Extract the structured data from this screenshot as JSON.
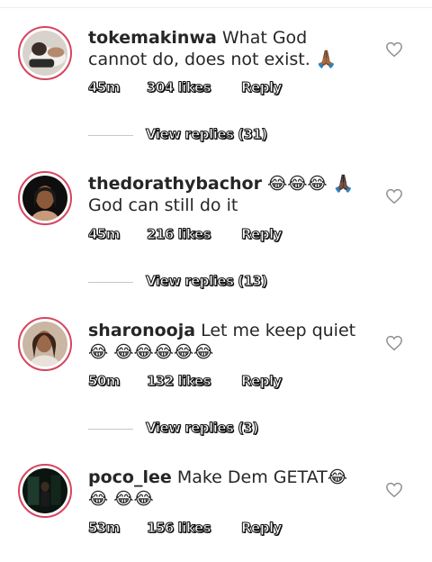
{
  "comments": [
    {
      "username": "tokemakinwa",
      "text": "What God cannot do, does not exist. 🙏🏾",
      "time": "45m",
      "likes": "304 likes",
      "reply": "Reply",
      "view_replies": "View replies (31)"
    },
    {
      "username": "thedorathybachor",
      "text": "😂😂😂 🙏🏿 God can still do it",
      "time": "45m",
      "likes": "216 likes",
      "reply": "Reply",
      "view_replies": "View replies (13)"
    },
    {
      "username": "sharonooja",
      "text": "Let me keep quiet 😂 😂😂😂😂😂",
      "time": "50m",
      "likes": "132 likes",
      "reply": "Reply",
      "view_replies": "View replies (3)"
    },
    {
      "username": "poco_lee",
      "text": "Make Dem GETAT😂😂 😂😂",
      "time": "53m",
      "likes": "156 likes",
      "reply": "Reply"
    }
  ],
  "icons": {
    "like": "heart-outline-icon"
  }
}
